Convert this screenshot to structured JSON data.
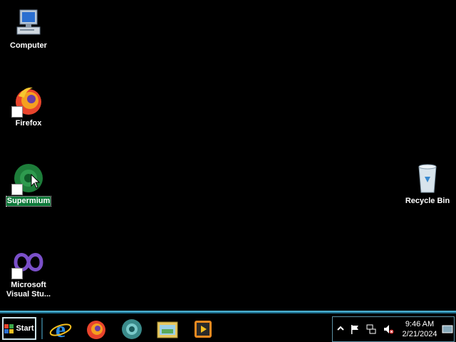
{
  "desktop": {
    "icons": [
      {
        "label": "Computer"
      },
      {
        "label": "Firefox"
      },
      {
        "label": "Supermium"
      },
      {
        "label": "Microsoft Visual Stu..."
      },
      {
        "label": "Recycle Bin"
      }
    ]
  },
  "taskbar": {
    "start_label": "Start",
    "pinned": [
      "internet-explorer-icon",
      "firefox-icon",
      "supermium-icon",
      "file-explorer-icon",
      "media-player-icon"
    ],
    "tray": {
      "time": "9:46 AM",
      "date": "2/21/2024"
    }
  },
  "colors": {
    "desktop": "#000000",
    "taskbar_border": "#4ab0d0",
    "selection": "#0d7a3a"
  }
}
